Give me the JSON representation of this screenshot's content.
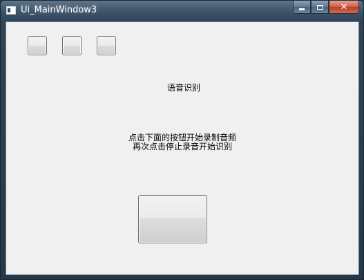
{
  "window": {
    "title": "Ui_MainWindow3"
  },
  "caption_buttons": {
    "close_glyph": "✕"
  },
  "main": {
    "heading": "语音识别",
    "instructions": [
      "点击下面的按钮开始录制音频",
      "再次点击停止录音开始识别"
    ]
  },
  "colors": {
    "client_background": "#f0f0f0",
    "close_button": "#c7402a"
  }
}
